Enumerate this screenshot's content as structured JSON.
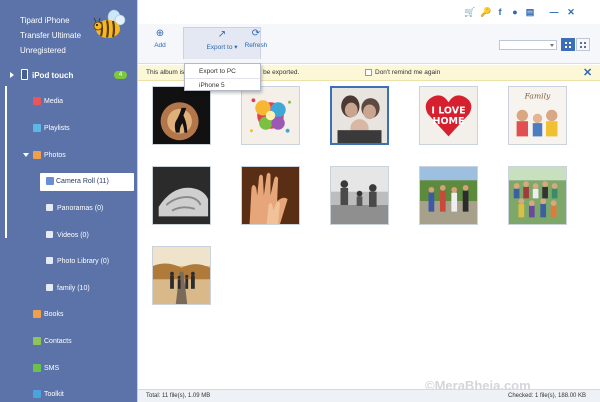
{
  "app": {
    "title_line1": "Tipard iPhone",
    "title_line2": "Transfer Ultimate",
    "title_line3": "Unregistered"
  },
  "device": {
    "name": "iPod touch",
    "badge": "4"
  },
  "sidebar": {
    "items": [
      {
        "label": "Media",
        "icon": "music-icon",
        "color": "#e8555a"
      },
      {
        "label": "Playlists",
        "icon": "playlist-icon",
        "color": "#5ab7e6"
      },
      {
        "label": "Photos",
        "icon": "photos-icon",
        "color": "#f0a04a"
      },
      {
        "label": "Camera Roll (11)",
        "icon": "camera-roll-icon"
      },
      {
        "label": "Panoramas (0)",
        "icon": "panorama-icon"
      },
      {
        "label": "Videos (0)",
        "icon": "video-icon"
      },
      {
        "label": "Photo Library (0)",
        "icon": "photo-library-icon"
      },
      {
        "label": "family (10)",
        "icon": "album-icon"
      },
      {
        "label": "Books",
        "icon": "books-icon",
        "color": "#f0a04a"
      },
      {
        "label": "Contacts",
        "icon": "contacts-icon",
        "color": "#8fc45a"
      },
      {
        "label": "SMS",
        "icon": "sms-icon",
        "color": "#6cc14c"
      },
      {
        "label": "Toolkit",
        "icon": "toolkit-icon",
        "color": "#4aa3df"
      }
    ]
  },
  "titlebar": {
    "icons": [
      "cart-icon",
      "key-icon",
      "facebook-icon",
      "chat-icon",
      "menu-icon",
      "minimize-icon",
      "close-icon"
    ]
  },
  "toolbar": {
    "add_label": "Add",
    "export_label": "Export to",
    "refresh_label": "Refresh"
  },
  "export_menu": {
    "items": [
      "Export to PC",
      "iPhone 5"
    ]
  },
  "notice": {
    "text_left": "This album is",
    "text_right": "nly be exported.",
    "checkbox_label": "Don't remind me again"
  },
  "photos": [
    {
      "name": "silhouette-sunset"
    },
    {
      "name": "paint-splash"
    },
    {
      "name": "family-portrait",
      "selected": true
    },
    {
      "name": "i-love-home"
    },
    {
      "name": "family-kids"
    },
    {
      "name": "hands-bw"
    },
    {
      "name": "baby-hands"
    },
    {
      "name": "family-beach-bw"
    },
    {
      "name": "family-group-outdoor"
    },
    {
      "name": "large-family-group"
    },
    {
      "name": "family-railroad"
    }
  ],
  "heart_text": [
    "I LOVE",
    "HOME"
  ],
  "family_caption": "Family",
  "status": {
    "left": "Total: 11 file(s), 1.09 MB",
    "right": "Checked: 1 file(s), 188.00 KB"
  },
  "watermark": "©MeraBheja.com"
}
